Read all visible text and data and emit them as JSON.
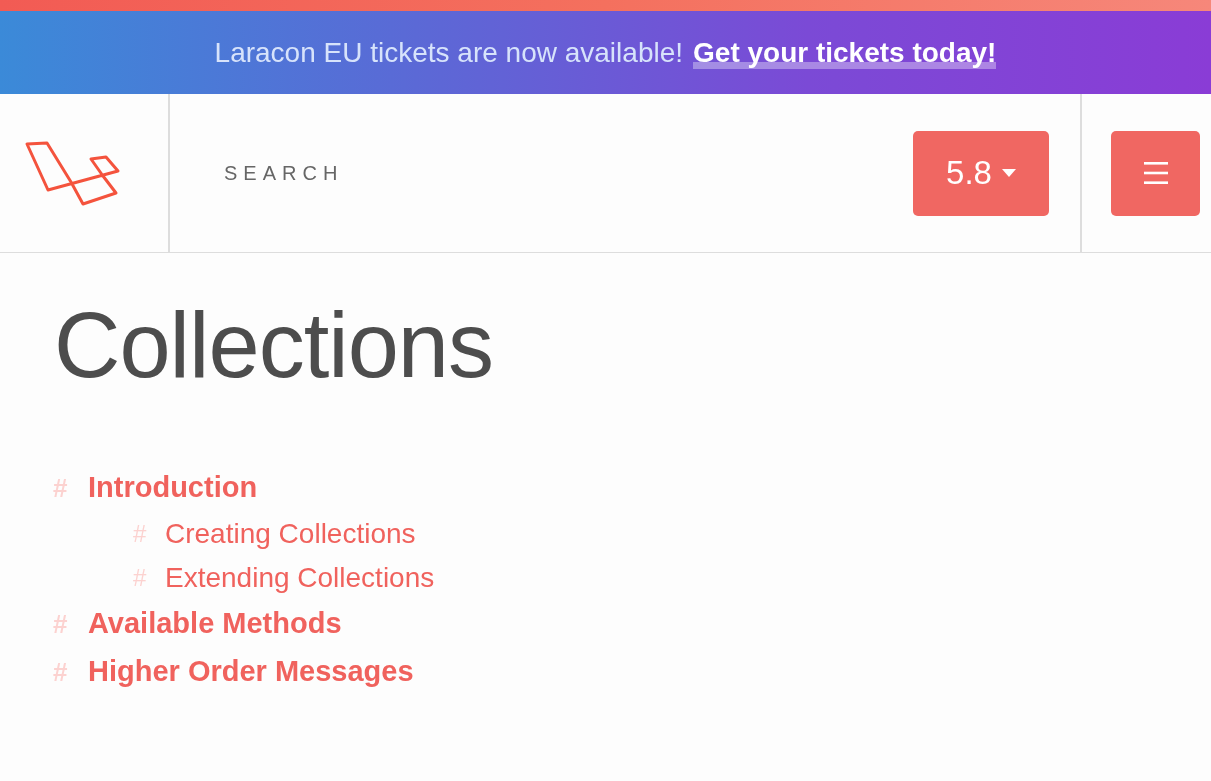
{
  "banner": {
    "text": "Laracon EU tickets are now available!",
    "link": "Get your tickets today!"
  },
  "header": {
    "search": {
      "placeholder": "SEARCH"
    },
    "version_button": {
      "label": "5.8"
    }
  },
  "page": {
    "title": "Collections"
  },
  "toc": [
    {
      "marker": "#",
      "label": "Introduction",
      "children": [
        {
          "marker": "#",
          "label": "Creating Collections"
        },
        {
          "marker": "#",
          "label": "Extending Collections"
        }
      ]
    },
    {
      "marker": "#",
      "label": "Available Methods"
    },
    {
      "marker": "#",
      "label": "Higher Order Messages"
    }
  ]
}
